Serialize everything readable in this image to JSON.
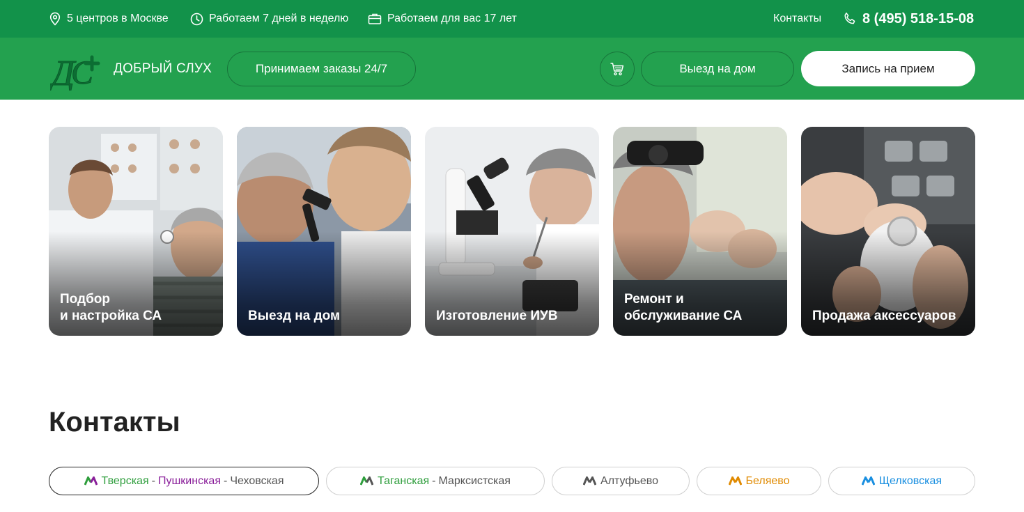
{
  "topbar": {
    "centers": "5 центров в Москве",
    "schedule": "Работаем 7 дней в неделю",
    "years": "Работаем для вас 17 лет",
    "contacts_link": "Контакты",
    "phone": "8 (495) 518-15-08"
  },
  "header": {
    "brand": "ДОБРЫЙ СЛУХ",
    "orders_button": "Принимаем заказы 24/7",
    "home_visit_button": "Выезд на дом",
    "appointment_button": "Запись на прием"
  },
  "services": [
    {
      "line1": "Подбор",
      "line2": "и настройка СА"
    },
    {
      "line1": "",
      "line2": "Выезд на дом"
    },
    {
      "line1": "",
      "line2": "Изготовление ИУВ"
    },
    {
      "line1": "Ремонт и",
      "line2": "обслуживание СА"
    },
    {
      "line1": "",
      "line2": "Продажа аксессуаров"
    }
  ],
  "contacts": {
    "title": "Контакты",
    "metro": [
      {
        "stations": [
          "Тверская",
          "Пушкинская",
          "Чеховская"
        ],
        "colors": [
          "#2f9e3d",
          "#8a1f9a",
          "#555555"
        ],
        "active": true
      },
      {
        "stations": [
          "Таганская",
          "Марксистская"
        ],
        "colors": [
          "#2f9e3d",
          "#555555"
        ],
        "active": false
      },
      {
        "stations": [
          "Алтуфьево"
        ],
        "colors": [
          "#555555"
        ],
        "active": false
      },
      {
        "stations": [
          "Беляево"
        ],
        "colors": [
          "#e08a00"
        ],
        "active": false
      },
      {
        "stations": [
          "Щелковская"
        ],
        "colors": [
          "#1a8fe0"
        ],
        "active": false
      }
    ]
  },
  "colors": {
    "topbar": "#12924a",
    "header": "#23a14f",
    "white": "#ffffff"
  }
}
